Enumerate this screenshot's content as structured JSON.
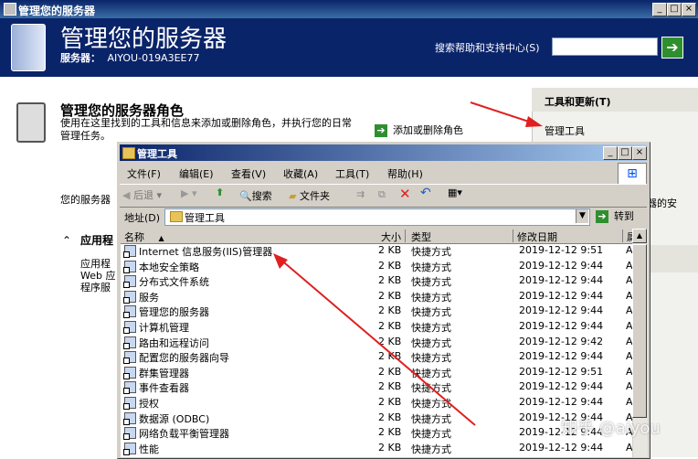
{
  "outer": {
    "title": "管理您的服务器",
    "header_title": "管理您的服务器",
    "server_label": "服务器：",
    "server_name": "AIYOU-019A3EE77",
    "search_label": "搜索帮助和支持中心(S)",
    "search_value": ""
  },
  "roles": {
    "title": "管理您的服务器角色",
    "desc": "使用在这里找到的工具和信息来添加或删除角色，并执行您的日常管理任务。",
    "add_remove": "添加或删除角色",
    "left_fragment": "您的服务器",
    "apps_heading": "应用程",
    "apps_line1": "应用程",
    "apps_line2": "Web 应",
    "apps_line3": "程序服"
  },
  "right_panel": {
    "header": "工具和更新(T)",
    "admin_tools": "管理工具",
    "fragment": "器的安"
  },
  "inner": {
    "title": "管理工具",
    "menu": [
      "文件(F)",
      "编辑(E)",
      "查看(V)",
      "收藏(A)",
      "工具(T)",
      "帮助(H)"
    ],
    "toolbar": {
      "back": "后退",
      "search": "搜索",
      "folders": "文件夹"
    },
    "address_label": "地址(D)",
    "address_value": "管理工具",
    "go_label": "转到",
    "columns": [
      "名称",
      "大小",
      "类型",
      "修改日期",
      "属"
    ],
    "rows": [
      {
        "name": "Internet 信息服务(IIS)管理器",
        "size": "2 KB",
        "type": "快捷方式",
        "date": "2019-12-12 9:51",
        "attr": "A"
      },
      {
        "name": "本地安全策略",
        "size": "2 KB",
        "type": "快捷方式",
        "date": "2019-12-12 9:44",
        "attr": "A"
      },
      {
        "name": "分布式文件系统",
        "size": "2 KB",
        "type": "快捷方式",
        "date": "2019-12-12 9:44",
        "attr": "A"
      },
      {
        "name": "服务",
        "size": "2 KB",
        "type": "快捷方式",
        "date": "2019-12-12 9:44",
        "attr": "A"
      },
      {
        "name": "管理您的服务器",
        "size": "2 KB",
        "type": "快捷方式",
        "date": "2019-12-12 9:44",
        "attr": "A"
      },
      {
        "name": "计算机管理",
        "size": "2 KB",
        "type": "快捷方式",
        "date": "2019-12-12 9:44",
        "attr": "A"
      },
      {
        "name": "路由和远程访问",
        "size": "2 KB",
        "type": "快捷方式",
        "date": "2019-12-12 9:42",
        "attr": "A"
      },
      {
        "name": "配置您的服务器向导",
        "size": "2 KB",
        "type": "快捷方式",
        "date": "2019-12-12 9:44",
        "attr": "A"
      },
      {
        "name": "群集管理器",
        "size": "2 KB",
        "type": "快捷方式",
        "date": "2019-12-12 9:51",
        "attr": "A"
      },
      {
        "name": "事件查看器",
        "size": "2 KB",
        "type": "快捷方式",
        "date": "2019-12-12 9:44",
        "attr": "A"
      },
      {
        "name": "授权",
        "size": "2 KB",
        "type": "快捷方式",
        "date": "2019-12-12 9:44",
        "attr": "A"
      },
      {
        "name": "数据源 (ODBC)",
        "size": "2 KB",
        "type": "快捷方式",
        "date": "2019-12-12 9:44",
        "attr": "A"
      },
      {
        "name": "网络负载平衡管理器",
        "size": "2 KB",
        "type": "快捷方式",
        "date": "2019-12-12 9:44",
        "attr": "A"
      },
      {
        "name": "性能",
        "size": "2 KB",
        "type": "快捷方式",
        "date": "2019-12-12 9:44",
        "attr": "A"
      }
    ]
  },
  "watermark": "知乎 @aiyou",
  "colors": {
    "title_blue": "#0a246a",
    "annotation_red": "#e02020",
    "go_green": "#2f8f2f"
  }
}
